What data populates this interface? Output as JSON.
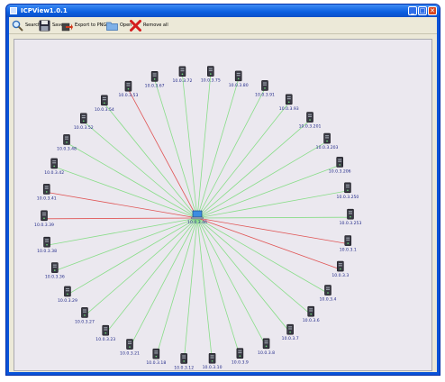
{
  "window": {
    "title": "ICPView1.0.1",
    "minimize_glyph": "_",
    "maximize_glyph": "□",
    "close_glyph": "✕"
  },
  "toolbar": {
    "search_label": "Search",
    "save_label": "Save",
    "export_label": "Export to PNG",
    "open_label": "Open",
    "remove_label": "Remove all",
    "search_icon": "magnifier-icon",
    "save_icon": "floppy-disk-icon",
    "export_icon": "export-arrow-icon",
    "open_icon": "folder-icon",
    "remove_icon": "red-x-icon"
  },
  "topology": {
    "center": {
      "label": "10.0.3.46",
      "icon": "laptop-icon"
    },
    "link_colors": {
      "normal": "#88dd88",
      "alert": "#e05555"
    },
    "nodes": [
      {
        "label": "10.0.3.75",
        "link": "normal"
      },
      {
        "label": "10.0.3.80",
        "link": "normal"
      },
      {
        "label": "10.0.3.91",
        "link": "normal"
      },
      {
        "label": "10.0.3.93",
        "link": "normal"
      },
      {
        "label": "10.0.3.201",
        "link": "normal"
      },
      {
        "label": "10.0.3.203",
        "link": "normal"
      },
      {
        "label": "10.0.3.206",
        "link": "normal"
      },
      {
        "label": "10.0.3.250",
        "link": "normal"
      },
      {
        "label": "10.0.3.253",
        "link": "normal"
      },
      {
        "label": "10.0.3.1",
        "link": "alert"
      },
      {
        "label": "10.0.3.3",
        "link": "alert"
      },
      {
        "label": "10.0.3.4",
        "link": "normal"
      },
      {
        "label": "10.0.3.6",
        "link": "normal"
      },
      {
        "label": "10.0.3.7",
        "link": "normal"
      },
      {
        "label": "10.0.3.8",
        "link": "normal"
      },
      {
        "label": "10.0.3.9",
        "link": "normal"
      },
      {
        "label": "10.0.3.10",
        "link": "normal"
      },
      {
        "label": "10.0.3.12",
        "link": "normal"
      },
      {
        "label": "10.0.3.18",
        "link": "normal"
      },
      {
        "label": "10.0.3.21",
        "link": "normal"
      },
      {
        "label": "10.0.3.23",
        "link": "normal"
      },
      {
        "label": "10.0.3.27",
        "link": "normal"
      },
      {
        "label": "10.0.3.29",
        "link": "normal"
      },
      {
        "label": "10.0.3.36",
        "link": "normal"
      },
      {
        "label": "10.0.3.38",
        "link": "normal"
      },
      {
        "label": "10.0.3.39",
        "link": "alert"
      },
      {
        "label": "10.0.3.41",
        "link": "alert"
      },
      {
        "label": "10.0.3.42",
        "link": "normal"
      },
      {
        "label": "10.0.3.48",
        "link": "normal"
      },
      {
        "label": "10.0.3.52",
        "link": "normal"
      },
      {
        "label": "10.0.3.54",
        "link": "normal"
      },
      {
        "label": "10.0.3.53",
        "link": "alert"
      },
      {
        "label": "10.0.3.67",
        "link": "normal"
      },
      {
        "label": "10.0.3.72",
        "link": "normal"
      }
    ]
  }
}
